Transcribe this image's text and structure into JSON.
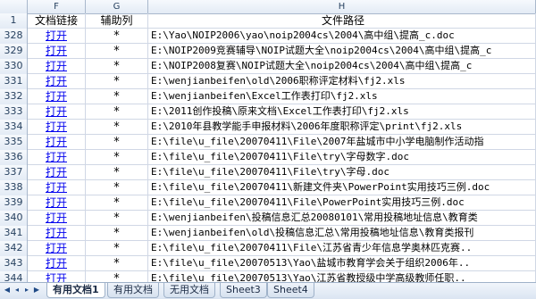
{
  "columns": {
    "rowhdr": "",
    "F": "F",
    "G": "G",
    "H": "H"
  },
  "header": {
    "row_num": "1",
    "F": "文档链接",
    "G": "辅助列",
    "H": "文件路径"
  },
  "rows": [
    {
      "num": "328",
      "link": "打开",
      "mark": "*",
      "path": "E:\\Yao\\NOIP2006\\yao\\noip2004cs\\2004\\高中组\\提高_c.doc"
    },
    {
      "num": "329",
      "link": "打开",
      "mark": "*",
      "path": "E:\\NOIP2009竞赛辅导\\NOIP试题大全\\noip2004cs\\2004\\高中组\\提高_c"
    },
    {
      "num": "330",
      "link": "打开",
      "mark": "*",
      "path": "E:\\NOIP2008复赛\\NOIP试题大全\\noip2004cs\\2004\\高中组\\提高_c"
    },
    {
      "num": "331",
      "link": "打开",
      "mark": "*",
      "path": "E:\\wenjianbeifen\\old\\2006职称评定材料\\fj2.xls"
    },
    {
      "num": "332",
      "link": "打开",
      "mark": "*",
      "path": "E:\\wenjianbeifen\\Excel工作表打印\\fj2.xls"
    },
    {
      "num": "333",
      "link": "打开",
      "mark": "*",
      "path": "E:\\2011创作投稿\\原来文档\\Excel工作表打印\\fj2.xls"
    },
    {
      "num": "334",
      "link": "打开",
      "mark": "*",
      "path": "E:\\2010年县教学能手申报材料\\2006年度职称评定\\print\\fj2.xls"
    },
    {
      "num": "335",
      "link": "打开",
      "mark": "*",
      "path": "E:\\file\\u_file\\20070411\\File\\2007年盐城市中小学电脑制作活动指"
    },
    {
      "num": "336",
      "link": "打开",
      "mark": "*",
      "path": "E:\\file\\u_file\\20070411\\File\\try\\字母数字.doc"
    },
    {
      "num": "337",
      "link": "打开",
      "mark": "*",
      "path": "E:\\file\\u_file\\20070411\\File\\try\\字母.doc"
    },
    {
      "num": "338",
      "link": "打开",
      "mark": "*",
      "path": "E:\\file\\u_file\\20070411\\新建文件夹\\PowerPoint实用技巧三例.doc"
    },
    {
      "num": "339",
      "link": "打开",
      "mark": "*",
      "path": "E:\\file\\u_file\\20070411\\File\\PowerPoint实用技巧三例.doc"
    },
    {
      "num": "340",
      "link": "打开",
      "mark": "*",
      "path": "E:\\wenjianbeifen\\投稿信息汇总20080101\\常用投稿地址信息\\教育类"
    },
    {
      "num": "341",
      "link": "打开",
      "mark": "*",
      "path": "E:\\wenjianbeifen\\old\\投稿信息汇总\\常用投稿地址信息\\教育类报刊"
    },
    {
      "num": "342",
      "link": "打开",
      "mark": "*",
      "path": "E:\\file\\u_file\\20070411\\File\\江苏省青少年信息学奥林匹克赛.."
    },
    {
      "num": "343",
      "link": "打开",
      "mark": "*",
      "path": "E:\\file\\u_file\\20070513\\Yao\\盐城市教育学会关于组织2006年.."
    },
    {
      "num": "344",
      "link": "打开",
      "mark": "*",
      "path": "E:\\file\\u_file\\20070513\\Yao\\江苏省教授级中学高级教师任职.."
    }
  ],
  "tabs": [
    "有用文档1",
    "有用文档",
    "无用文档",
    "Sheet3",
    "Sheet4"
  ],
  "active_tab": "有用文档1",
  "colors": {
    "header_bg": "#e3ebf5",
    "link": "#0000ee",
    "grid": "#d0d7e5"
  }
}
